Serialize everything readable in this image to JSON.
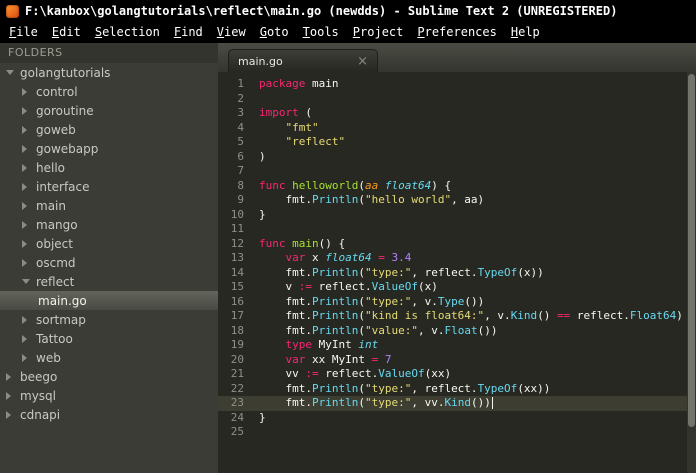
{
  "window": {
    "title": "F:\\kanbox\\golangtutorials\\reflect\\main.go (newdds) - Sublime Text 2 (UNREGISTERED)"
  },
  "menu": {
    "items": [
      "File",
      "Edit",
      "Selection",
      "Find",
      "View",
      "Goto",
      "Tools",
      "Project",
      "Preferences",
      "Help"
    ]
  },
  "sidebar": {
    "header": "FOLDERS",
    "items": [
      {
        "label": "golangtutorials",
        "level": 0,
        "arrow": "expanded",
        "selected": false
      },
      {
        "label": "control",
        "level": 1,
        "arrow": "collapsed",
        "selected": false
      },
      {
        "label": "goroutine",
        "level": 1,
        "arrow": "collapsed",
        "selected": false
      },
      {
        "label": "goweb",
        "level": 1,
        "arrow": "collapsed",
        "selected": false
      },
      {
        "label": "gowebapp",
        "level": 1,
        "arrow": "collapsed",
        "selected": false
      },
      {
        "label": "hello",
        "level": 1,
        "arrow": "collapsed",
        "selected": false
      },
      {
        "label": "interface",
        "level": 1,
        "arrow": "collapsed",
        "selected": false
      },
      {
        "label": "main",
        "level": 1,
        "arrow": "collapsed",
        "selected": false
      },
      {
        "label": "mango",
        "level": 1,
        "arrow": "collapsed",
        "selected": false
      },
      {
        "label": "object",
        "level": 1,
        "arrow": "collapsed",
        "selected": false
      },
      {
        "label": "oscmd",
        "level": 1,
        "arrow": "collapsed",
        "selected": false
      },
      {
        "label": "reflect",
        "level": 1,
        "arrow": "expanded",
        "selected": false
      },
      {
        "label": "main.go",
        "level": 2,
        "arrow": "none",
        "selected": true
      },
      {
        "label": "sortmap",
        "level": 1,
        "arrow": "collapsed",
        "selected": false
      },
      {
        "label": "Tattoo",
        "level": 1,
        "arrow": "collapsed",
        "selected": false
      },
      {
        "label": "web",
        "level": 1,
        "arrow": "collapsed",
        "selected": false
      },
      {
        "label": "beego",
        "level": 0,
        "arrow": "collapsed",
        "selected": false
      },
      {
        "label": "mysql",
        "level": 0,
        "arrow": "collapsed",
        "selected": false
      },
      {
        "label": "cdnapi",
        "level": 0,
        "arrow": "collapsed",
        "selected": false
      }
    ]
  },
  "editor": {
    "tab": {
      "label": "main.go",
      "close_glyph": "×"
    },
    "cursor_line": 23,
    "colors": {
      "background": "#272822",
      "plain": "#f8f8f2",
      "keyword": "#f92672",
      "string": "#e6db74",
      "number": "#ae81ff",
      "support_function": "#66d9ef",
      "type_italic": "#66d9ef",
      "function_name": "#a6e22e",
      "parameter": "#fd971f",
      "line_number": "#8f908a",
      "current_line": "#3e3d32"
    },
    "lines": [
      [
        [
          "k",
          "package"
        ],
        [
          "p",
          " main"
        ]
      ],
      [],
      [
        [
          "k",
          "import"
        ],
        [
          "p",
          " ("
        ]
      ],
      [
        [
          "p",
          "    "
        ],
        [
          "s",
          "\"fmt\""
        ]
      ],
      [
        [
          "p",
          "    "
        ],
        [
          "s",
          "\"reflect\""
        ]
      ],
      [
        [
          "p",
          ")"
        ]
      ],
      [],
      [
        [
          "k",
          "func"
        ],
        [
          "p",
          " "
        ],
        [
          "fd",
          "helloworld"
        ],
        [
          "p",
          "("
        ],
        [
          "pa",
          "aa"
        ],
        [
          "p",
          " "
        ],
        [
          "ty",
          "float64"
        ],
        [
          "p",
          ") {"
        ]
      ],
      [
        [
          "p",
          "    fmt."
        ],
        [
          "fn",
          "Println"
        ],
        [
          "p",
          "("
        ],
        [
          "s",
          "\"hello world\""
        ],
        [
          "p",
          ", aa)"
        ]
      ],
      [
        [
          "p",
          "}"
        ]
      ],
      [],
      [
        [
          "k",
          "func"
        ],
        [
          "p",
          " "
        ],
        [
          "fd",
          "main"
        ],
        [
          "p",
          "() {"
        ]
      ],
      [
        [
          "p",
          "    "
        ],
        [
          "k",
          "var"
        ],
        [
          "p",
          " x "
        ],
        [
          "ty",
          "float64"
        ],
        [
          "p",
          " "
        ],
        [
          "op",
          "="
        ],
        [
          "p",
          " "
        ],
        [
          "n",
          "3.4"
        ]
      ],
      [
        [
          "p",
          "    fmt."
        ],
        [
          "fn",
          "Println"
        ],
        [
          "p",
          "("
        ],
        [
          "s",
          "\"type:\""
        ],
        [
          "p",
          ", reflect."
        ],
        [
          "fn",
          "TypeOf"
        ],
        [
          "p",
          "(x))"
        ]
      ],
      [
        [
          "p",
          "    v "
        ],
        [
          "op",
          ":="
        ],
        [
          "p",
          " reflect."
        ],
        [
          "fn",
          "ValueOf"
        ],
        [
          "p",
          "(x)"
        ]
      ],
      [
        [
          "p",
          "    fmt."
        ],
        [
          "fn",
          "Println"
        ],
        [
          "p",
          "("
        ],
        [
          "s",
          "\"type:\""
        ],
        [
          "p",
          ", v."
        ],
        [
          "fn",
          "Type"
        ],
        [
          "p",
          "())"
        ]
      ],
      [
        [
          "p",
          "    fmt."
        ],
        [
          "fn",
          "Println"
        ],
        [
          "p",
          "("
        ],
        [
          "s",
          "\"kind is float64:\""
        ],
        [
          "p",
          ", v."
        ],
        [
          "fn",
          "Kind"
        ],
        [
          "p",
          "() "
        ],
        [
          "op",
          "=="
        ],
        [
          "p",
          " reflect."
        ],
        [
          "fn",
          "Float64"
        ],
        [
          "p",
          ")"
        ]
      ],
      [
        [
          "p",
          "    fmt."
        ],
        [
          "fn",
          "Println"
        ],
        [
          "p",
          "("
        ],
        [
          "s",
          "\"value:\""
        ],
        [
          "p",
          ", v."
        ],
        [
          "fn",
          "Float"
        ],
        [
          "p",
          "())"
        ]
      ],
      [
        [
          "p",
          "    "
        ],
        [
          "k",
          "type"
        ],
        [
          "p",
          " MyInt "
        ],
        [
          "ty",
          "int"
        ]
      ],
      [
        [
          "p",
          "    "
        ],
        [
          "k",
          "var"
        ],
        [
          "p",
          " xx MyInt "
        ],
        [
          "op",
          "="
        ],
        [
          "p",
          " "
        ],
        [
          "n",
          "7"
        ]
      ],
      [
        [
          "p",
          "    vv "
        ],
        [
          "op",
          ":="
        ],
        [
          "p",
          " reflect."
        ],
        [
          "fn",
          "ValueOf"
        ],
        [
          "p",
          "(xx)"
        ]
      ],
      [
        [
          "p",
          "    fmt."
        ],
        [
          "fn",
          "Println"
        ],
        [
          "p",
          "("
        ],
        [
          "s",
          "\"type:\""
        ],
        [
          "p",
          ", reflect."
        ],
        [
          "fn",
          "TypeOf"
        ],
        [
          "p",
          "(xx))"
        ]
      ],
      [
        [
          "p",
          "    fmt."
        ],
        [
          "fn",
          "Println"
        ],
        [
          "p",
          "("
        ],
        [
          "s",
          "\"type:\""
        ],
        [
          "p",
          ", vv."
        ],
        [
          "fn",
          "Kind"
        ],
        [
          "p",
          "())"
        ]
      ],
      [
        [
          "p",
          "}"
        ]
      ],
      []
    ]
  }
}
